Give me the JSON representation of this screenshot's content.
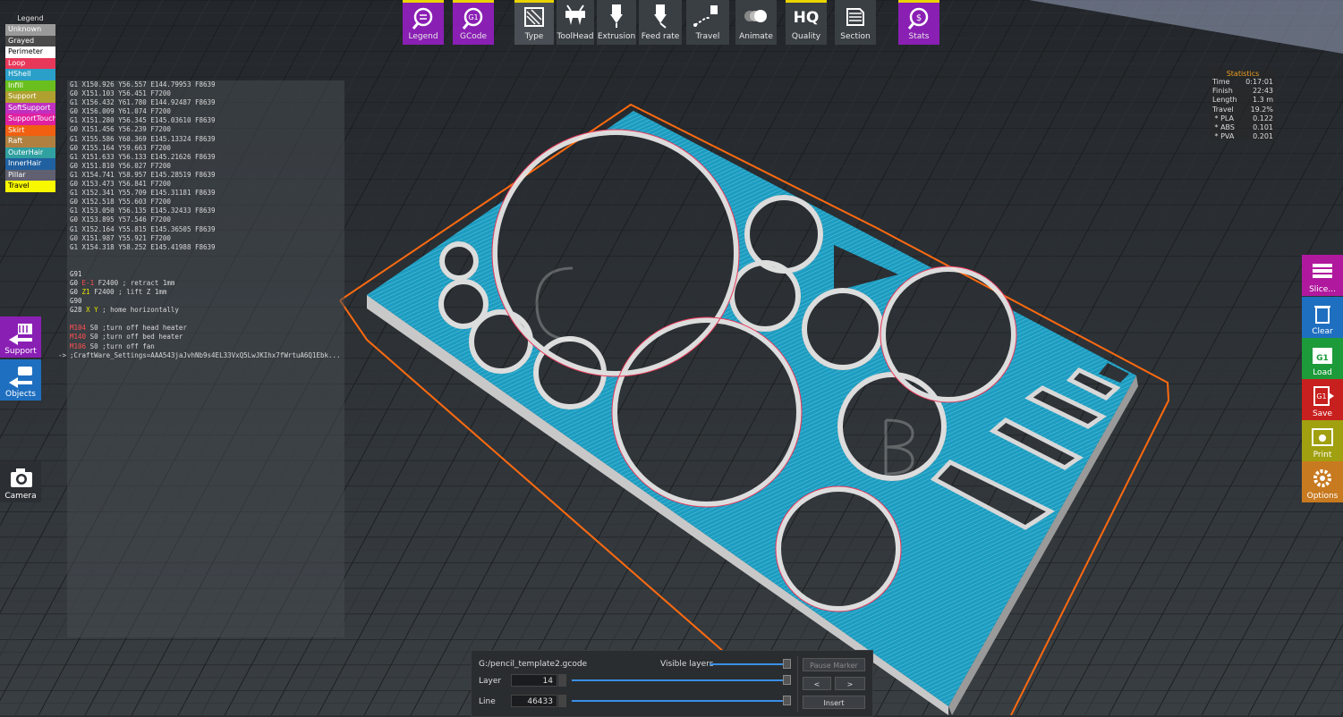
{
  "toolbar": {
    "legend": "Legend",
    "gcode": "GCode",
    "type": "Type",
    "toolhead": "ToolHead",
    "extrusion": "Extrusion",
    "feedrate": "Feed rate",
    "travel": "Travel",
    "animate": "Animate",
    "quality_icon": "HQ",
    "quality": "Quality",
    "section": "Section",
    "stats": "Stats",
    "gcode_icon": "G1"
  },
  "legend": {
    "title": "Legend",
    "items": [
      {
        "label": "Unknown",
        "color": "#9a9a9a",
        "text_color": "#ffffff"
      },
      {
        "label": "Grayed",
        "color": "#4a4a4a",
        "text_color": "#ffffff"
      },
      {
        "label": "Perimeter",
        "color": "#ffffff",
        "text_color": "#000000"
      },
      {
        "label": "Loop",
        "color": "#e8385a",
        "text_color": "#ffffff"
      },
      {
        "label": "HShell",
        "color": "#2aa0c8",
        "text_color": "#ffffff"
      },
      {
        "label": "Infill",
        "color": "#6abf1e",
        "text_color": "#ffffff"
      },
      {
        "label": "Support",
        "color": "#b0a030",
        "text_color": "#ffffff"
      },
      {
        "label": "SoftSupport",
        "color": "#c030c0",
        "text_color": "#ffffff"
      },
      {
        "label": "SupportTouch",
        "color": "#e020a0",
        "text_color": "#ffffff"
      },
      {
        "label": "Skirt",
        "color": "#f06010",
        "text_color": "#ffffff"
      },
      {
        "label": "Raft",
        "color": "#b08040",
        "text_color": "#ffffff"
      },
      {
        "label": "OuterHair",
        "color": "#30a0a0",
        "text_color": "#ffffff"
      },
      {
        "label": "InnerHair",
        "color": "#2060a0",
        "text_color": "#ffffff"
      },
      {
        "label": "Pillar",
        "color": "#606070",
        "text_color": "#ffffff"
      },
      {
        "label": "Travel",
        "color": "#f8f800",
        "text_color": "#000000"
      }
    ]
  },
  "gcode_lines": [
    {
      "c": "G1",
      "x": "X150.926",
      "y": "Y56.557",
      "e": "E144.79953",
      "f": "F8639"
    },
    {
      "c": "G0",
      "x": "X151.103",
      "y": "Y56.451",
      "e": "",
      "f": "F7200"
    },
    {
      "c": "G1",
      "x": "X156.432",
      "y": "Y61.780",
      "e": "E144.92487",
      "f": "F8639"
    },
    {
      "c": "G0",
      "x": "X156.009",
      "y": "Y61.074",
      "e": "",
      "f": "F7200"
    },
    {
      "c": "G1",
      "x": "X151.280",
      "y": "Y56.345",
      "e": "E145.03610",
      "f": "F8639"
    },
    {
      "c": "G0",
      "x": "X151.456",
      "y": "Y56.239",
      "e": "",
      "f": "F7200"
    },
    {
      "c": "G1",
      "x": "X155.586",
      "y": "Y60.369",
      "e": "E145.13324",
      "f": "F8639"
    },
    {
      "c": "G0",
      "x": "X155.164",
      "y": "Y59.663",
      "e": "",
      "f": "F7200"
    },
    {
      "c": "G1",
      "x": "X151.633",
      "y": "Y56.133",
      "e": "E145.21626",
      "f": "F8639"
    },
    {
      "c": "G0",
      "x": "X151.810",
      "y": "Y56.027",
      "e": "",
      "f": "F7200"
    },
    {
      "c": "G1",
      "x": "X154.741",
      "y": "Y58.957",
      "e": "E145.28519",
      "f": "F8639"
    },
    {
      "c": "G0",
      "x": "X153.473",
      "y": "Y56.841",
      "e": "",
      "f": "F7200"
    },
    {
      "c": "G1",
      "x": "X152.341",
      "y": "Y55.709",
      "e": "E145.31181",
      "f": "F8639"
    },
    {
      "c": "G0",
      "x": "X152.518",
      "y": "Y55.603",
      "e": "",
      "f": "F7200"
    },
    {
      "c": "G1",
      "x": "X153.050",
      "y": "Y56.135",
      "e": "E145.32433",
      "f": "F8639"
    },
    {
      "c": "G0",
      "x": "X153.895",
      "y": "Y57.546",
      "e": "",
      "f": "F7200"
    },
    {
      "c": "G1",
      "x": "X152.164",
      "y": "Y55.815",
      "e": "E145.36505",
      "f": "F8639"
    },
    {
      "c": "G0",
      "x": "X151.987",
      "y": "Y55.921",
      "e": "",
      "f": "F7200"
    },
    {
      "c": "G1",
      "x": "X154.318",
      "y": "Y58.252",
      "e": "E145.41988",
      "f": "F8639"
    }
  ],
  "gcode_tail": [
    {
      "k": "G91",
      "r": ""
    },
    {
      "k": "G0 ",
      "e": "E-1",
      "r": " F2400 ; retract 1mm"
    },
    {
      "k": "G0 ",
      "z": "Z1",
      "r": " F2400 ; lift Z 1mm"
    },
    {
      "k": "G90",
      "r": ""
    },
    {
      "k": "G28 ",
      "xy": "X Y",
      "r": " ; home horizontally"
    },
    {
      "k": "",
      "r": ""
    },
    {
      "k": "M104",
      "r": " S0 ;turn off head heater"
    },
    {
      "k": "M140",
      "r": " S0 ;turn off bed heater"
    },
    {
      "k": "M106",
      "r": " S0 ;turn off fan"
    },
    {
      "k": "",
      "r": ";CraftWare_Settings=AAA543jaJvhNb9s4EL33VxQ5LwJKIhx7fWrtuA6Q1Ebk..."
    }
  ],
  "gcode_arrow": "->",
  "stats": {
    "title": "Statistics",
    "rows": [
      {
        "k": "Time",
        "v": "0:17:01"
      },
      {
        "k": "Finish",
        "v": "22:43"
      },
      {
        "k": "Length",
        "v": "1.3 m"
      },
      {
        "k": "Travel",
        "v": "19.2%"
      },
      {
        "k": " * PLA",
        "v": "0.122"
      },
      {
        "k": " * ABS",
        "v": "0.101"
      },
      {
        "k": " * PVA",
        "v": "0.201"
      }
    ]
  },
  "left_buttons": {
    "support": "Support",
    "objects": "Objects",
    "camera": "Camera"
  },
  "right_buttons": {
    "slice": "Slice...",
    "clear": "Clear",
    "load": "Load",
    "load_icon": "G1",
    "save": "Save",
    "save_icon": "G1",
    "print": "Print",
    "options": "Options"
  },
  "bottom": {
    "file": "G:/pencil_template2.gcode",
    "visible_layers": "Visible layers",
    "pause_marker": "Pause Marker",
    "layer_label": "Layer",
    "layer_value": "14",
    "line_label": "Line",
    "line_value": "46433",
    "prev": "<",
    "next": ">",
    "insert": "Insert"
  },
  "colors": {
    "model_fill": "#1a9fc0",
    "wall": "#e6e6e6",
    "skirt": "#ff6a10",
    "toolbar_purple": "#8a1fb4",
    "accent": "#e9d400"
  }
}
